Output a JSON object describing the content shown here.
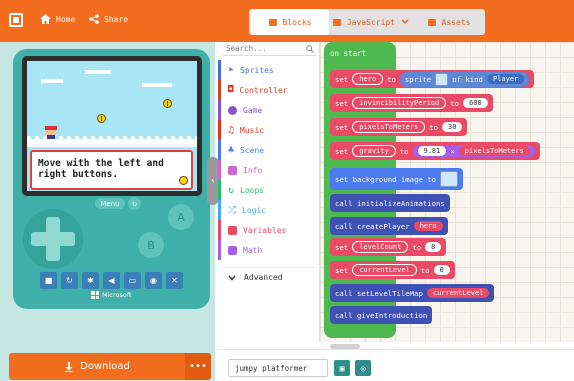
{
  "header": {
    "home_label": "Home",
    "share_label": "Share",
    "tabs": [
      {
        "label": "Blocks",
        "active": true
      },
      {
        "label": "JavaScript",
        "active": false
      },
      {
        "label": "Assets",
        "active": false
      }
    ]
  },
  "simulator": {
    "dialog_text": "Move with the left and\nright buttons.",
    "menu_label": "Menu",
    "button_a": "A",
    "button_b": "B",
    "brand": "Microsoft",
    "download_label": "Download",
    "more_label": "•••"
  },
  "toolbox": {
    "search_placeholder": "Search...",
    "categories": [
      {
        "label": "Sprites",
        "color": "#4b6ed6"
      },
      {
        "label": "Controller",
        "color": "#d54322"
      },
      {
        "label": "Game",
        "color": "#8854d0"
      },
      {
        "label": "Music",
        "color": "#e63022"
      },
      {
        "label": "Scene",
        "color": "#4b7bec"
      },
      {
        "label": "Info",
        "color": "#cf63cf"
      },
      {
        "label": "Loops",
        "color": "#20bf6b"
      },
      {
        "label": "Logic",
        "color": "#45aaf2"
      },
      {
        "label": "Variables",
        "color": "#e94a65"
      },
      {
        "label": "Math",
        "color": "#a55eea"
      }
    ],
    "advanced_label": "Advanced"
  },
  "workspace": {
    "on_start": "on start",
    "blocks": {
      "b1": {
        "set": "set",
        "var": "hero",
        "to": "to",
        "sprite": "sprite",
        "ofkind": "of kind",
        "kind": "Player"
      },
      "b2": {
        "set": "set",
        "var": "invincibilityPeriod",
        "to": "to",
        "val": "600"
      },
      "b3": {
        "set": "set",
        "var": "pixelsToMeters",
        "to": "to",
        "val": "30"
      },
      "b4": {
        "set": "set",
        "var": "gravity",
        "to": "to",
        "val": "9.81",
        "op": "×",
        "var2": "pixelsToMeters"
      },
      "b5": {
        "label": "set background image to"
      },
      "b6": {
        "label": "call initializeAnimations"
      },
      "b7": {
        "label": "call createPlayer",
        "arg": "hero"
      },
      "b8": {
        "set": "set",
        "var": "levelCount",
        "to": "to",
        "val": "8"
      },
      "b9": {
        "set": "set",
        "var": "currentLevel",
        "to": "to",
        "val": "0"
      },
      "b10": {
        "label": "call setLevelTileMap",
        "arg": "currentLevel"
      },
      "b11": {
        "label": "call giveIntroduction"
      }
    }
  },
  "bottombar": {
    "project_name": "jumpy platformer"
  },
  "colors": {
    "brand_orange": "#f26d1d",
    "sim_bg": "#c6e6e1",
    "device_teal": "#3fb0a9"
  }
}
